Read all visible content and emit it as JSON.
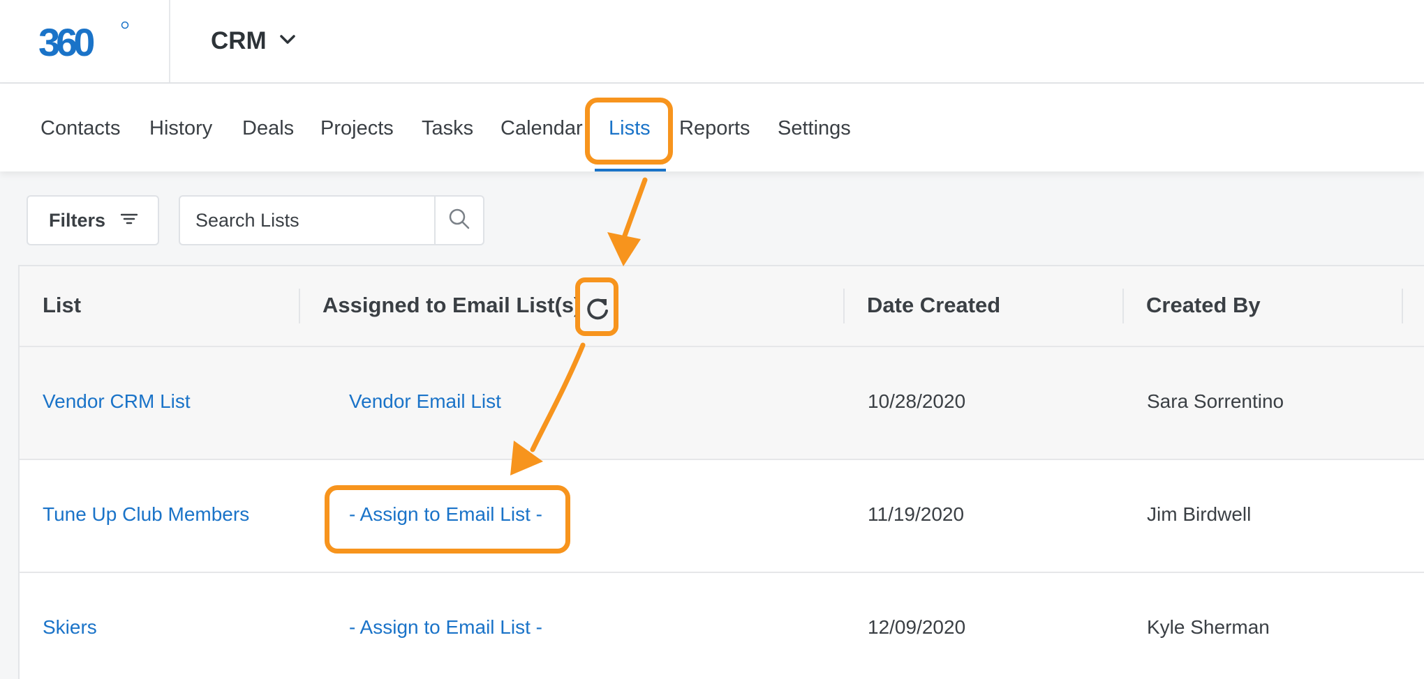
{
  "header": {
    "logo_text": "360",
    "app_name": "CRM"
  },
  "nav": {
    "items": [
      {
        "label": "Contacts"
      },
      {
        "label": "History"
      },
      {
        "label": "Deals"
      },
      {
        "label": "Projects"
      },
      {
        "label": "Tasks"
      },
      {
        "label": "Calendar"
      },
      {
        "label": "Lists",
        "active": true
      },
      {
        "label": "Reports"
      },
      {
        "label": "Settings"
      }
    ]
  },
  "toolbar": {
    "filters_label": "Filters",
    "search_placeholder": "Search Lists"
  },
  "table": {
    "columns": [
      "List",
      "Assigned to Email List(s)",
      "Date Created",
      "Created By"
    ],
    "rows": [
      {
        "list": "Vendor CRM List",
        "assigned": "Vendor Email List",
        "date": "10/28/2020",
        "created_by": "Sara Sorrentino"
      },
      {
        "list": "Tune Up Club Members",
        "assigned": "- Assign to Email List -",
        "date": "11/19/2020",
        "created_by": "Jim Birdwell"
      },
      {
        "list": "Skiers",
        "assigned": "- Assign to Email List -",
        "date": "12/09/2020",
        "created_by": "Kyle Sherman"
      }
    ]
  },
  "colors": {
    "accent": "#1a73c8",
    "annotation": "#f7941d"
  },
  "icons": {
    "app_switcher": "chevron-down-icon",
    "filters": "filter-icon",
    "search": "search-icon",
    "refresh": "refresh-icon"
  }
}
